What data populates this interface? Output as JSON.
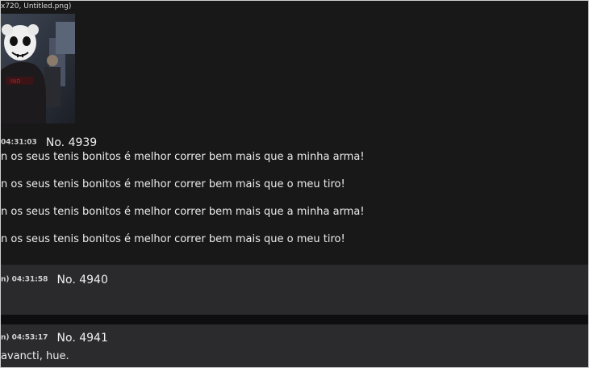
{
  "post_main": {
    "file_info": "x720, Untitled.png)",
    "time": "04:31:03",
    "number": "No. 4939",
    "lines": [
      "n os seus tenis bonitos é melhor correr bem mais que a minha arma!",
      "n os seus tenis bonitos é melhor correr bem mais que o meu tiro!",
      "n os seus tenis bonitos é melhor correr bem mais que a minha arma!",
      "n os seus tenis bonitos é melhor correr bem mais que o meu tiro!"
    ]
  },
  "reply_4940": {
    "time": "n) 04:31:58",
    "number": "No. 4940"
  },
  "reply_4941": {
    "time": "n) 04:53:17",
    "number": "No. 4941",
    "text": "avancti, hue."
  },
  "colors": {
    "page_bg": "#171719",
    "reply_bg": "#2a2a2d",
    "text": "#ececec"
  }
}
